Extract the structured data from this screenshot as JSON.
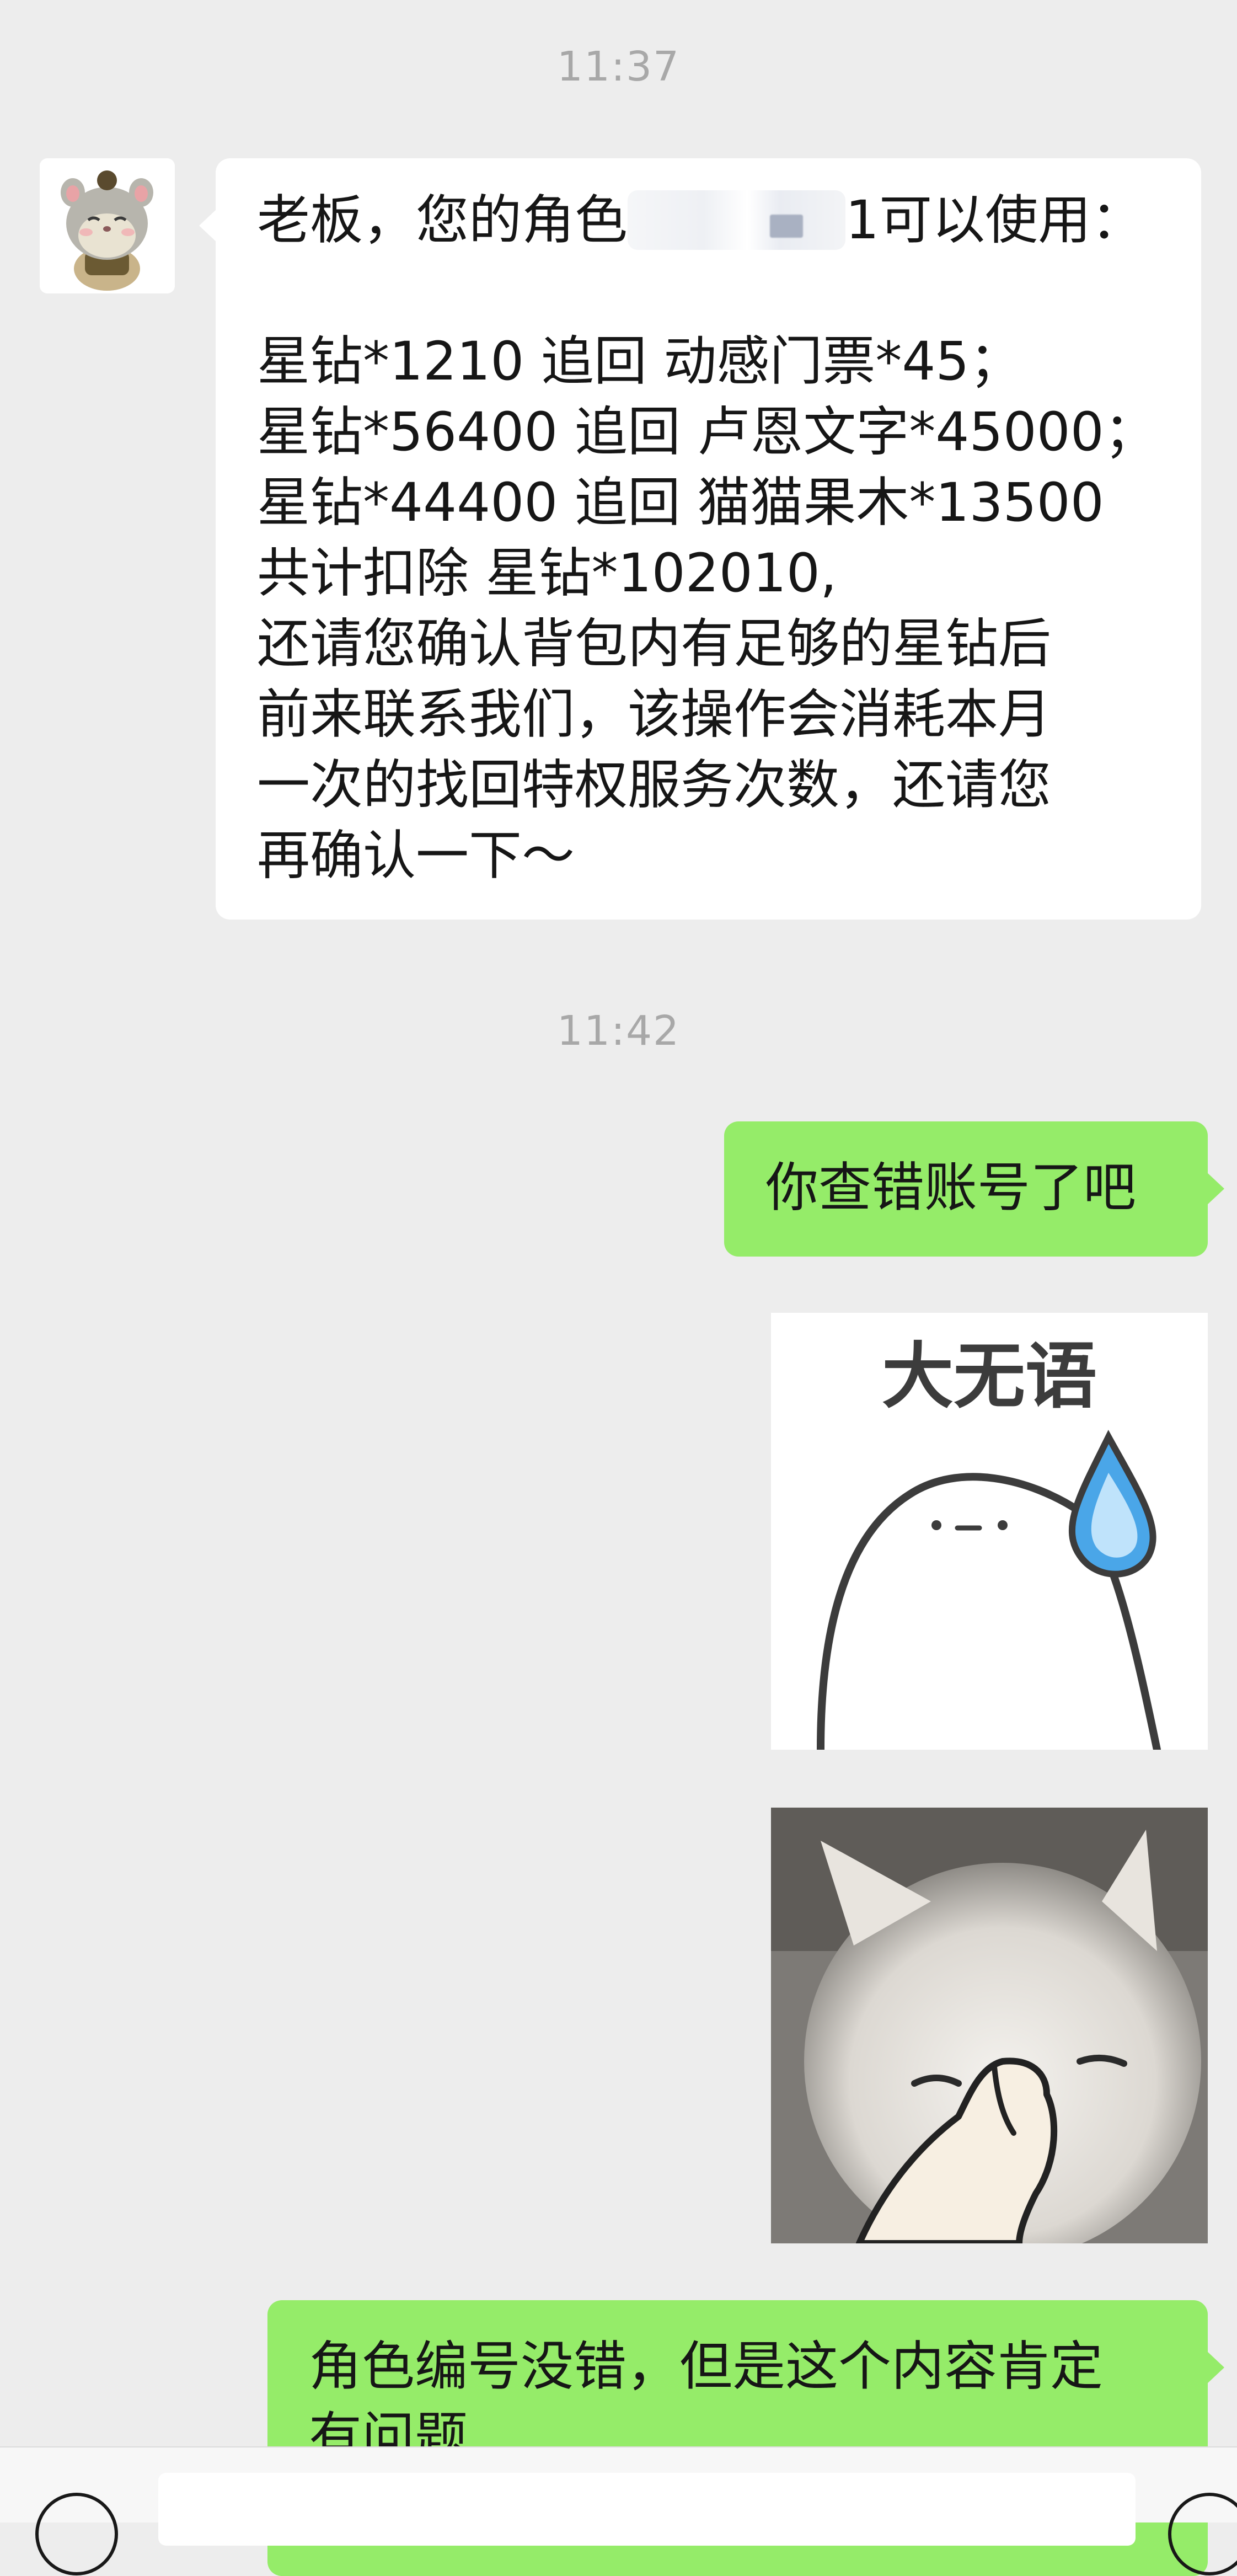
{
  "chat": {
    "timestamps": [
      "11:37",
      "11:42"
    ],
    "incoming": {
      "line_prefix": "老板，您的角色",
      "line_suffix": "1可以使用：",
      "lines": [
        "星钻*1210 追回 动感门票*45；",
        "星钻*56400 追回 卢恩文字*45000；",
        "星钻*44400 追回 猫猫果木*13500",
        "共计扣除 星钻*102010,",
        "还请您确认背包内有足够的星钻后",
        "前来联系我们，该操作会消耗本月",
        "一次的找回特权服务次数，还请您",
        "再确认一下～"
      ]
    },
    "outgoing": {
      "message1": "你查错账号了吧",
      "message3_line1": "角色编号没错，但是这个内容肯定",
      "message3_line2": "有问题"
    },
    "stickers": {
      "sticker1_text": "大无语"
    }
  },
  "input_bar": {
    "placeholder": ""
  },
  "icons": {
    "avatar": "hamster-avatar",
    "voice": "voice-icon",
    "emoji": "emoji-icon"
  },
  "colors": {
    "background": "#ededed",
    "bubble_in": "#ffffff",
    "bubble_out": "#95ec69",
    "timestamp": "#a8a8a8"
  }
}
